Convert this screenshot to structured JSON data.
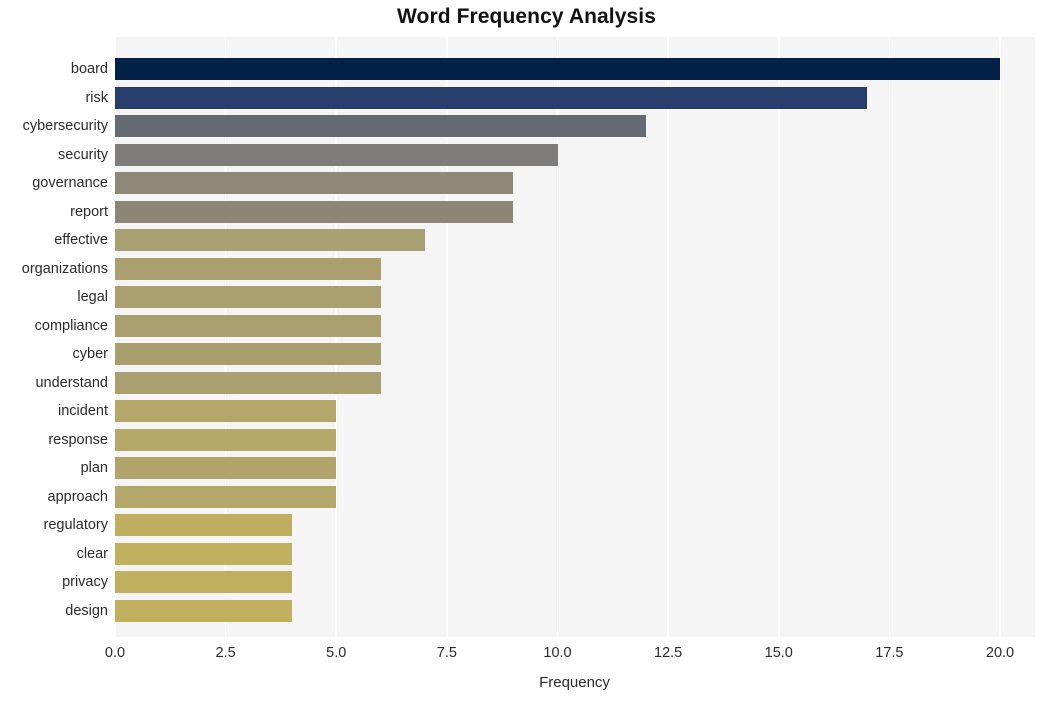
{
  "chart_data": {
    "type": "bar",
    "orientation": "horizontal",
    "title": "Word Frequency Analysis",
    "xlabel": "Frequency",
    "ylabel": "",
    "categories": [
      "board",
      "risk",
      "cybersecurity",
      "security",
      "governance",
      "report",
      "effective",
      "organizations",
      "legal",
      "compliance",
      "cyber",
      "understand",
      "incident",
      "response",
      "plan",
      "approach",
      "regulatory",
      "clear",
      "privacy",
      "design"
    ],
    "values": [
      20,
      17,
      12,
      10,
      9,
      9,
      7,
      6,
      6,
      6,
      6,
      6,
      5,
      5,
      5,
      5,
      4,
      4,
      4,
      4
    ],
    "bar_colors": [
      "#042147",
      "#273e6d",
      "#666a73",
      "#7e7d7b",
      "#8d8878",
      "#8b8678",
      "#a89f72",
      "#ab9f6d",
      "#aaa06f",
      "#aa9f6e",
      "#a99e6d",
      "#aa9f6e",
      "#b5a769",
      "#b5a869",
      "#b2a56c",
      "#b4a76a",
      "#bfae5f",
      "#c0b05f",
      "#c0af5f",
      "#c1b060"
    ],
    "xlim": [
      0.0,
      20.5
    ],
    "xticks": [
      "0.0",
      "2.5",
      "5.0",
      "7.5",
      "10.0",
      "12.5",
      "15.0",
      "17.5",
      "20.0"
    ],
    "xtick_values": [
      0.0,
      2.5,
      5.0,
      7.5,
      10.0,
      12.5,
      15.0,
      17.5,
      20.0
    ],
    "grid": "vertical",
    "legend": "none",
    "plot_background": "#f5f5f6",
    "figure_background": "#ffffff",
    "gridline_color": "#ffffff"
  }
}
